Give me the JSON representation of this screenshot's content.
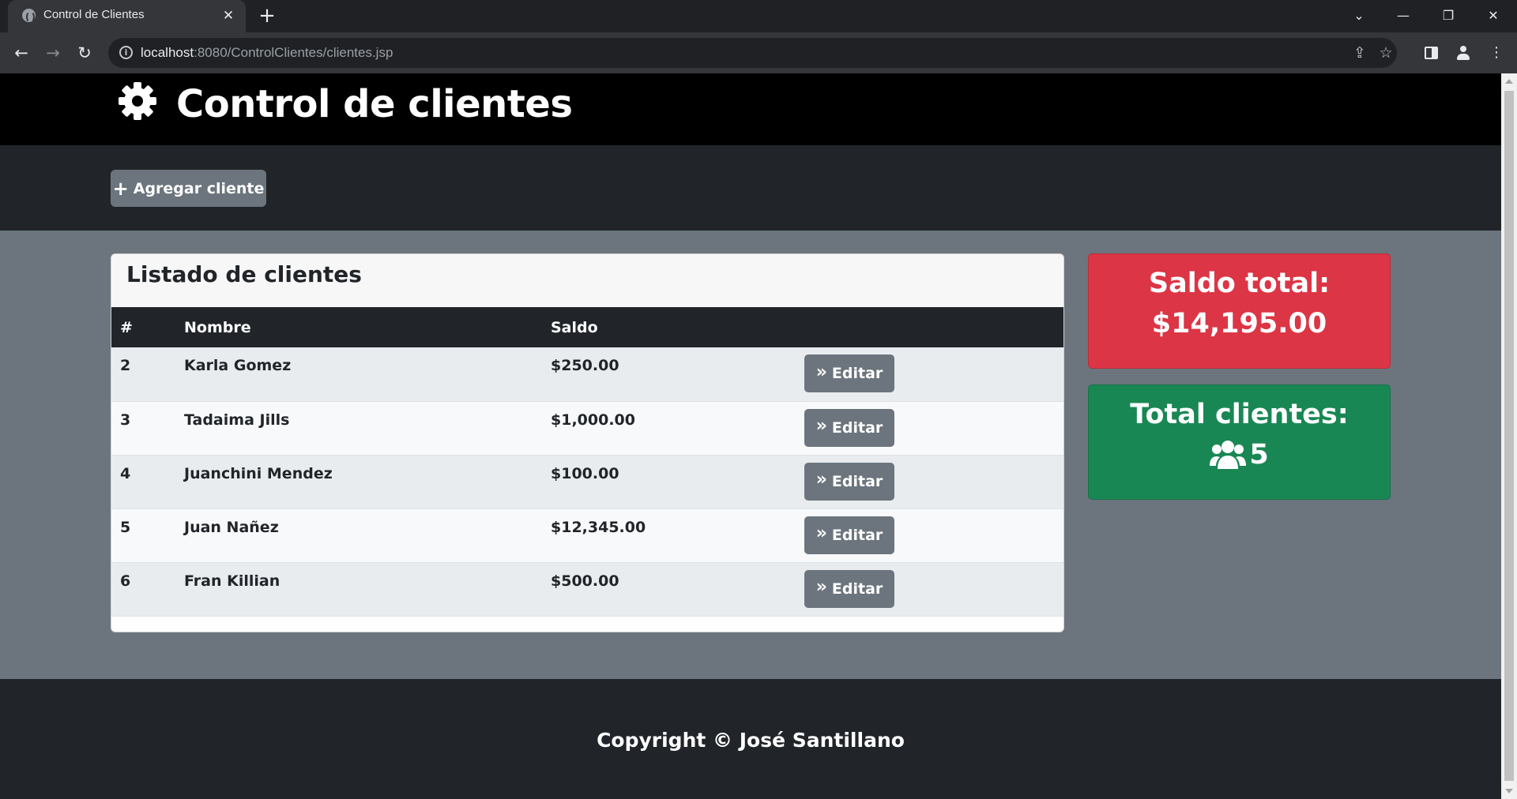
{
  "browser": {
    "tab_title": "Control de Clientes",
    "tab_close_glyph": "✕",
    "new_tab_glyph": "+",
    "url_host": "localhost",
    "url_rest": ":8080/ControlClientes/clientes.jsp",
    "window_controls": {
      "dropdown": "⌄",
      "minimize": "—",
      "restore": "❐",
      "close": "✕"
    },
    "nav": {
      "back": "←",
      "forward": "→",
      "reload": "↻"
    },
    "icons": [
      "globe-icon",
      "info-icon",
      "share-icon",
      "star-icon",
      "side-panel-icon",
      "profile-icon",
      "kebab-menu-icon"
    ]
  },
  "header": {
    "title": "Control de clientes",
    "icon": "gear-icon"
  },
  "actions": {
    "add_label": "Agregar cliente",
    "add_icon": "+"
  },
  "clients": {
    "card_title": "Listado de clientes",
    "columns": [
      "#",
      "Nombre",
      "Saldo",
      ""
    ],
    "edit_label": "Editar",
    "edit_icon": "»",
    "rows": [
      {
        "id": "2",
        "name": "Karla Gomez",
        "balance": "$250.00"
      },
      {
        "id": "3",
        "name": "Tadaima Jills",
        "balance": "$1,000.00"
      },
      {
        "id": "4",
        "name": "Juanchini Mendez",
        "balance": "$100.00"
      },
      {
        "id": "5",
        "name": "Juan Nañez",
        "balance": "$12,345.00"
      },
      {
        "id": "6",
        "name": "Fran Killian",
        "balance": "$500.00"
      }
    ]
  },
  "stats": {
    "balance_label": "Saldo total:",
    "balance_value": "$14,195.00",
    "count_label": "Total clientes:",
    "count_value": "5",
    "count_icon": "users-icon"
  },
  "footer": {
    "copyright": "Copyright © José Santillano"
  },
  "colors": {
    "header_bg": "#000000",
    "dark_bg": "#212529",
    "page_bg": "#6c757d",
    "danger": "#dc3545",
    "success": "#198754",
    "secondary_button": "#6c757d"
  }
}
